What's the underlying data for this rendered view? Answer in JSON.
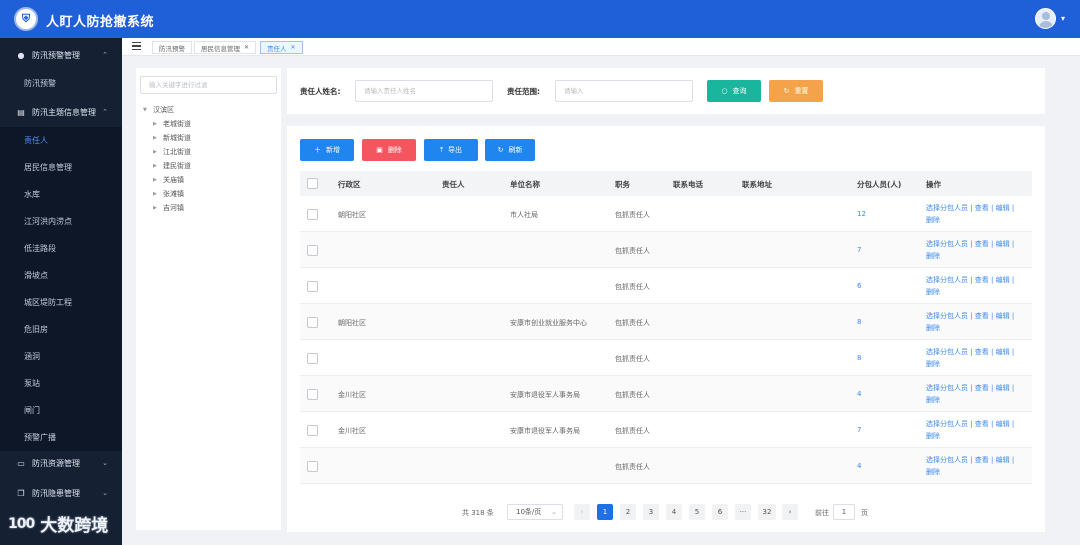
{
  "header": {
    "app_title": "人盯人防抢撤系统",
    "logo_icon": "shield-logo-icon",
    "user_icon": "user-avatar-icon"
  },
  "sidebar": {
    "groups": [
      {
        "label": "防汛预警管理",
        "icon": "pin-icon",
        "expanded": true
      },
      {
        "label": "防汛主题信息管理",
        "icon": "building-icon",
        "expanded": true
      },
      {
        "label": "防汛资源管理",
        "icon": "card-icon",
        "expanded": false
      },
      {
        "label": "防汛隐患管理",
        "icon": "copy-icon",
        "expanded": false
      }
    ],
    "warning_items": [
      "防汛预警"
    ],
    "topic_items": [
      "责任人",
      "居民信息管理",
      "水库",
      "江河洪内涝点",
      "低洼路段",
      "滑坡点",
      "城区堤防工程",
      "危旧房",
      "涵洞",
      "泵站",
      "闸门",
      "预警广播"
    ],
    "active_item": "责任人"
  },
  "tabs": {
    "items": [
      "防汛预警",
      "居民信息管理",
      "责任人"
    ],
    "active": "责任人"
  },
  "tree": {
    "search_placeholder": "输入关键字进行过滤",
    "root": "汉滨区",
    "children": [
      "老城街道",
      "新城街道",
      "江北街道",
      "建民街道",
      "关庙镇",
      "张滩镇",
      "吉河镇"
    ]
  },
  "filter": {
    "name_label": "责任人姓名:",
    "name_placeholder": "请输入责任人姓名",
    "scope_label": "责任范围:",
    "scope_placeholder": "请输入",
    "search_button": "查询",
    "reset_button": "重置"
  },
  "toolbar": {
    "add": "新增",
    "delete": "删除",
    "export": "导出",
    "refresh": "刷新"
  },
  "table": {
    "headers": [
      "行政区",
      "责任人",
      "单位名称",
      "职务",
      "联系电话",
      "联系地址",
      "分包人员(人)",
      "操作"
    ],
    "rows": [
      {
        "district": "朝阳社区",
        "person": "",
        "unit": "市人社局",
        "duty": "包抓责任人",
        "phone": "",
        "address": "",
        "count": "12"
      },
      {
        "district": "",
        "person": "",
        "unit": "",
        "duty": "包抓责任人",
        "phone": "",
        "address": "",
        "count": "7"
      },
      {
        "district": "",
        "person": "",
        "unit": "",
        "duty": "包抓责任人",
        "phone": "",
        "address": "",
        "count": "6"
      },
      {
        "district": "朝阳社区",
        "person": "",
        "unit": "安康市创业就业服务中心",
        "duty": "包抓责任人",
        "phone": "",
        "address": "",
        "count": "8"
      },
      {
        "district": "",
        "person": "",
        "unit": "",
        "duty": "包抓责任人",
        "phone": "",
        "address": "",
        "count": "8"
      },
      {
        "district": "金川社区",
        "person": "",
        "unit": "安康市退役军人事务局",
        "duty": "包抓责任人",
        "phone": "",
        "address": "",
        "count": "4"
      },
      {
        "district": "金川社区",
        "person": "",
        "unit": "安康市退役军人事务局",
        "duty": "包抓责任人",
        "phone": "",
        "address": "",
        "count": "7"
      },
      {
        "district": "",
        "person": "",
        "unit": "",
        "duty": "包抓责任人",
        "phone": "",
        "address": "",
        "count": "4"
      }
    ],
    "ops_line1": "选择分包人员 | 查看 | 编辑 |",
    "ops_line2": "删除"
  },
  "pagination": {
    "total": "共 318 条",
    "page_size": "10条/页",
    "pages": [
      "1",
      "2",
      "3",
      "4",
      "5",
      "6",
      "···",
      "32"
    ],
    "current": "1",
    "goto_label": "前往",
    "goto_value": "1",
    "goto_suffix": "页"
  },
  "watermark": {
    "mark": "100",
    "text": "大数跨境"
  }
}
